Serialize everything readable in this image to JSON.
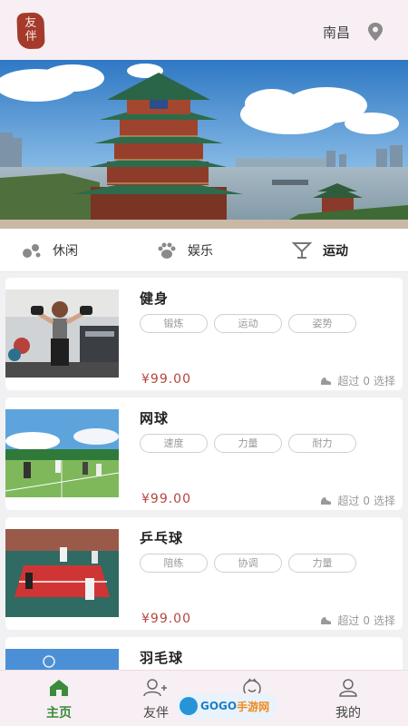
{
  "header": {
    "logo_chars": [
      "友",
      "伴"
    ],
    "city": "南昌",
    "location_icon": "location-pin-icon"
  },
  "categories": [
    {
      "label": "休闲",
      "icon": "bubbles-icon",
      "active": false
    },
    {
      "label": "娱乐",
      "icon": "paw-icon",
      "active": false
    },
    {
      "label": "运动",
      "icon": "cocktail-glass-icon",
      "active": true
    }
  ],
  "activities": [
    {
      "title": "健身",
      "tags": [
        "锻炼",
        "运动",
        "姿势"
      ],
      "price": "¥99.00",
      "stats_prefix": "超过",
      "count": "0",
      "stats_suffix": "选择"
    },
    {
      "title": "网球",
      "tags": [
        "速度",
        "力量",
        "耐力"
      ],
      "price": "¥99.00",
      "stats_prefix": "超过",
      "count": "0",
      "stats_suffix": "选择"
    },
    {
      "title": "乒乓球",
      "tags": [
        "陪练",
        "协调",
        "力量"
      ],
      "price": "¥99.00",
      "stats_prefix": "超过",
      "count": "0",
      "stats_suffix": "选择"
    },
    {
      "title": "羽毛球"
    }
  ],
  "bottom_nav": [
    {
      "label": "主页",
      "icon": "home-icon",
      "active": true
    },
    {
      "label": "友伴",
      "icon": "add-friend-icon",
      "active": false
    },
    {
      "label": "卦",
      "icon": "fortune-icon",
      "active": false
    },
    {
      "label": "我的",
      "icon": "user-icon",
      "active": false
    }
  ],
  "watermark": {
    "prefix": "GOGO",
    "suffix": "手游网"
  },
  "colors": {
    "accent_green": "#3a8b3a",
    "price_red": "#b4463f",
    "logo_red": "#a53a2c",
    "header_bg": "#f7eff3"
  }
}
